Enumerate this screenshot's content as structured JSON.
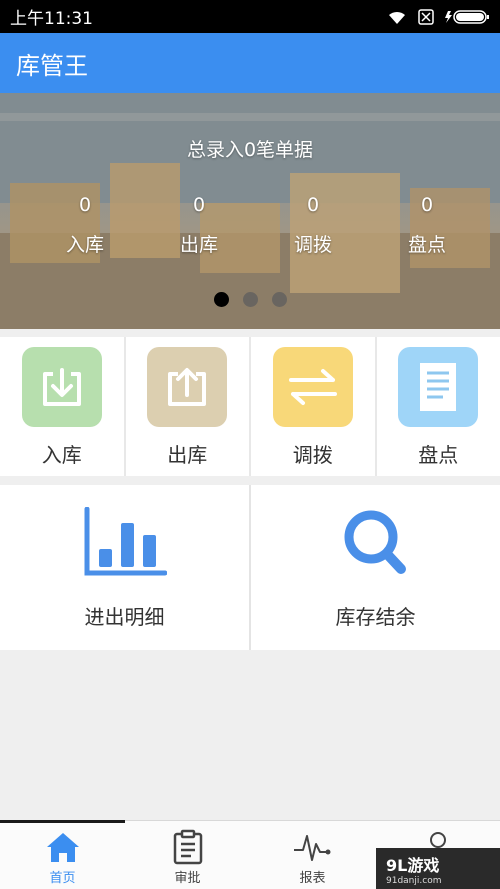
{
  "status_bar": {
    "time": "上午11:31"
  },
  "app_bar": {
    "title": "库管王"
  },
  "banner": {
    "headline": "总录入0笔单据",
    "stats": [
      {
        "count": "0",
        "label": "入库"
      },
      {
        "count": "0",
        "label": "出库"
      },
      {
        "count": "0",
        "label": "调拨"
      },
      {
        "count": "0",
        "label": "盘点"
      }
    ],
    "page_count": 3,
    "active_page": 1
  },
  "actions": [
    {
      "label": "入库",
      "icon": "download-box-icon",
      "color": "#b7dfae"
    },
    {
      "label": "出库",
      "icon": "upload-box-icon",
      "color": "#dccfb0"
    },
    {
      "label": "调拨",
      "icon": "swap-arrows-icon",
      "color": "#f8d879"
    },
    {
      "label": "盘点",
      "icon": "document-list-icon",
      "color": "#9fd5f8"
    }
  ],
  "reports": [
    {
      "label": "进出明细",
      "icon": "bar-chart-icon"
    },
    {
      "label": "库存结余",
      "icon": "magnifier-icon"
    }
  ],
  "tabs": [
    {
      "label": "首页",
      "icon": "home-icon",
      "active": true
    },
    {
      "label": "审批",
      "icon": "clipboard-icon",
      "active": false
    },
    {
      "label": "报表",
      "icon": "pulse-icon",
      "active": false
    },
    {
      "label": "",
      "icon": "user-icon",
      "active": false
    }
  ],
  "watermark": {
    "main": "9L游戏",
    "sub": "91danji.com"
  },
  "colors": {
    "primary": "#3b8ef0",
    "accent_icon": "#4a8fe8"
  }
}
